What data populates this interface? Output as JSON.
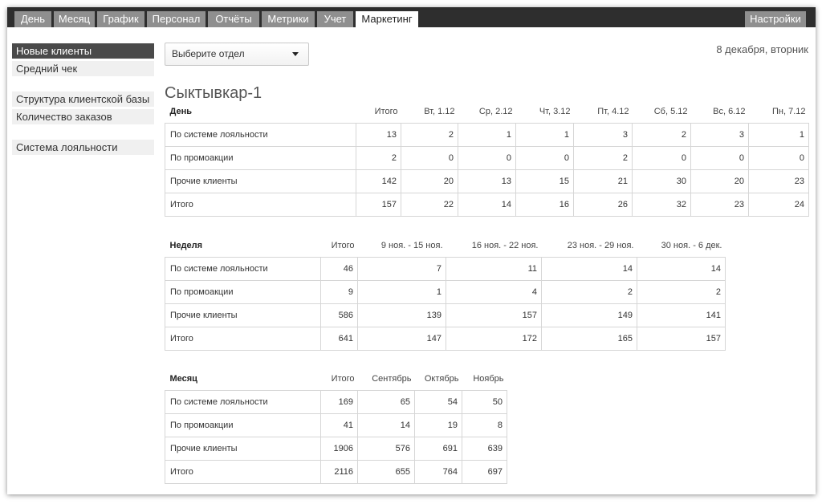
{
  "nav": {
    "tabs": [
      "День",
      "Месяц",
      "График",
      "Персонал",
      "Отчёты",
      "Метрики",
      "Учет",
      "Маркетинг"
    ],
    "active_tab": "Маркетинг",
    "settings_label": "Настройки"
  },
  "sidebar": {
    "items": [
      "Новые клиенты",
      "Средний чек",
      "Структура клиентской базы",
      "Количество заказов",
      "Система лояльности"
    ],
    "active_item": "Новые клиенты"
  },
  "department_select": {
    "value": "Выберите отдел",
    "icon": "caret-down-icon"
  },
  "date": "8 декабря, вторник",
  "location_title": "Сыктывкар-1",
  "colors": {
    "nav_bg": "#2e2e2e",
    "tab_bg": "#8f8f8f",
    "sidebar_active_bg": "#4a4a4a",
    "sidebar_bg": "#f0f0f0"
  },
  "day_table": {
    "headers": [
      "День",
      "Итого",
      "Вт, 1.12",
      "Ср, 2.12",
      "Чт, 3.12",
      "Пт, 4.12",
      "Сб, 5.12",
      "Вс, 6.12",
      "Пн, 7.12"
    ],
    "rows": [
      [
        "По системе лояльности",
        "13",
        "2",
        "1",
        "1",
        "3",
        "2",
        "3",
        "1"
      ],
      [
        "По промоакции",
        "2",
        "0",
        "0",
        "0",
        "2",
        "0",
        "0",
        "0"
      ],
      [
        "Прочие клиенты",
        "142",
        "20",
        "13",
        "15",
        "21",
        "30",
        "20",
        "23"
      ],
      [
        "Итого",
        "157",
        "22",
        "14",
        "16",
        "26",
        "32",
        "23",
        "24"
      ]
    ]
  },
  "week_table": {
    "headers": [
      "Неделя",
      "Итого",
      "9 ноя. - 15 ноя.",
      "16 ноя. - 22 ноя.",
      "23 ноя. - 29 ноя.",
      "30 ноя. - 6 дек."
    ],
    "rows": [
      [
        "По системе лояльности",
        "46",
        "7",
        "11",
        "14",
        "14"
      ],
      [
        "По промоакции",
        "9",
        "1",
        "4",
        "2",
        "2"
      ],
      [
        "Прочие клиенты",
        "586",
        "139",
        "157",
        "149",
        "141"
      ],
      [
        "Итого",
        "641",
        "147",
        "172",
        "165",
        "157"
      ]
    ]
  },
  "month_table": {
    "headers": [
      "Месяц",
      "Итого",
      "Сентябрь",
      "Октябрь",
      "Ноябрь"
    ],
    "rows": [
      [
        "По системе лояльности",
        "169",
        "65",
        "54",
        "50"
      ],
      [
        "По промоакции",
        "41",
        "14",
        "19",
        "8"
      ],
      [
        "Прочие клиенты",
        "1906",
        "576",
        "691",
        "639"
      ],
      [
        "Итого",
        "2116",
        "655",
        "764",
        "697"
      ]
    ]
  }
}
